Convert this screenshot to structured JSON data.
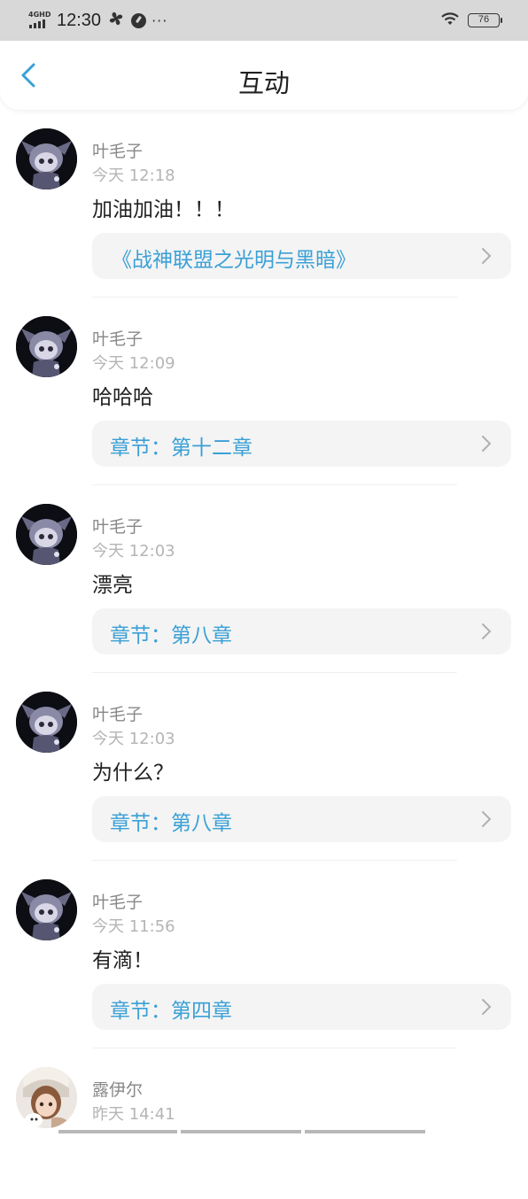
{
  "status_bar": {
    "network": "4GHD",
    "time": "12:30",
    "more": "···",
    "battery": "76"
  },
  "header": {
    "title": "互动"
  },
  "comments": [
    {
      "user": "叶毛子",
      "time": "今天 12:18",
      "text": "加油加油！！！",
      "link": "《战神联盟之光明与黑暗》"
    },
    {
      "user": "叶毛子",
      "time": "今天 12:09",
      "text": "哈哈哈",
      "link": "章节：第十二章"
    },
    {
      "user": "叶毛子",
      "time": "今天 12:03",
      "text": "漂亮",
      "link": "章节：第八章"
    },
    {
      "user": "叶毛子",
      "time": "今天 12:03",
      "text": "为什么？",
      "link": "章节：第八章"
    },
    {
      "user": "叶毛子",
      "time": "今天 11:56",
      "text": "有滴！",
      "link": "章节：第四章"
    },
    {
      "user": "露伊尔",
      "time": "昨天 14:41"
    }
  ],
  "icons": {
    "back": "chevron-left-icon",
    "link_arrow": "chevron-right-icon"
  },
  "colors": {
    "accent": "#3aa0d6",
    "status_bar_bg": "#d8d8d8",
    "link_box_bg": "#f4f4f4"
  }
}
